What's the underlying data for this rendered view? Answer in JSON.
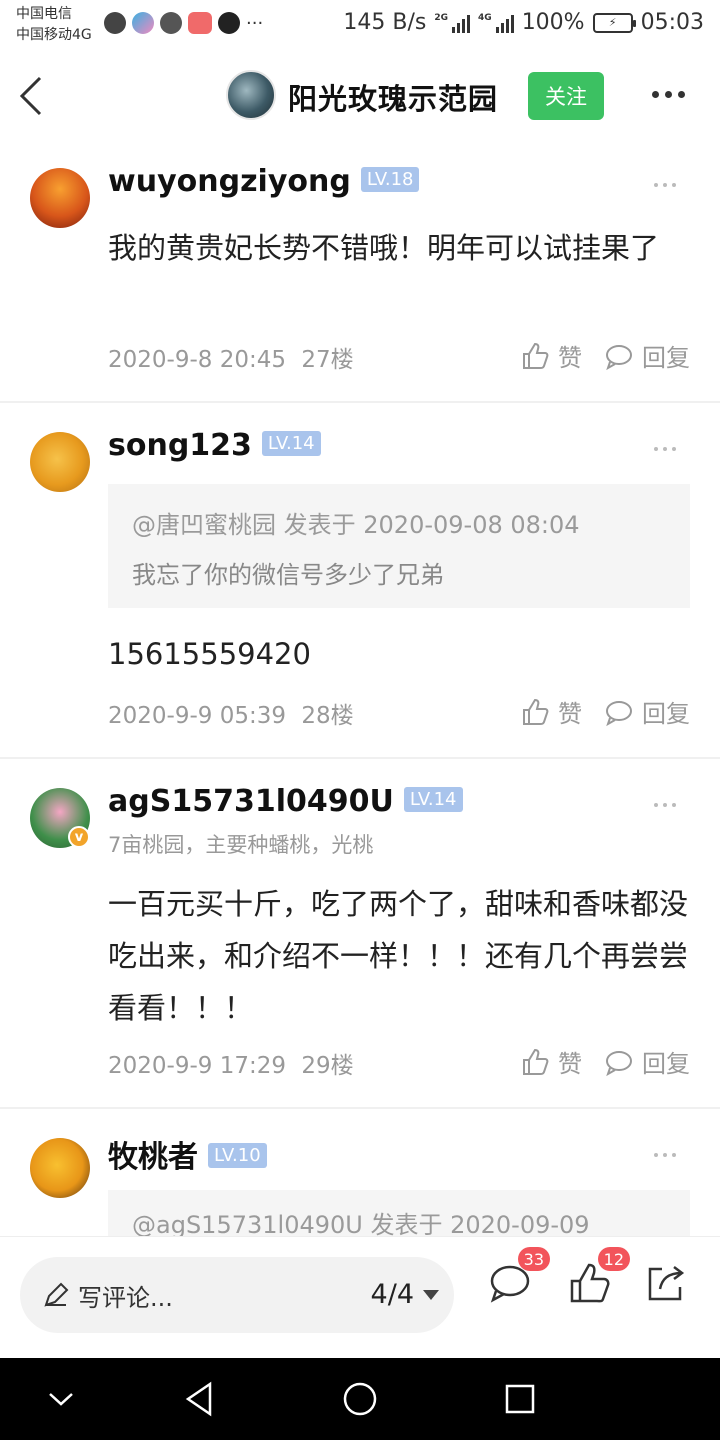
{
  "status_bar": {
    "carrier_1": "中国电信",
    "carrier_2": "中国移动4G",
    "net_speed": "145 B/s",
    "net_2g": "2G",
    "net_4g": "4G",
    "battery": "100%",
    "time": "05:03"
  },
  "header": {
    "title": "阳光玫瑰示范园",
    "follow_label": "关注"
  },
  "posts": [
    {
      "username": "wuyongziyong",
      "level": "LV.18",
      "text": "我的黄贵妃长势不错哦！明年可以试挂果了",
      "date": "2020-9-8 20:45",
      "floor": "27楼",
      "like_label": "赞",
      "reply_label": "回复"
    },
    {
      "username": "song123",
      "level": "LV.14",
      "quote_header": "@唐凹蜜桃园 发表于 2020-09-08 08:04",
      "quote_text": "我忘了你的微信号多少了兄弟",
      "text": "15615559420",
      "date": "2020-9-9 05:39",
      "floor": "28楼",
      "like_label": "赞",
      "reply_label": "回复"
    },
    {
      "username": "agS15731l0490U",
      "level": "LV.14",
      "subtitle": "7亩桃园，主要种蟠桃，光桃",
      "text": "一百元买十斤，吃了两个了，甜味和香味都没吃出来，和介绍不一样！！！还有几个再尝尝看看！！！",
      "date": "2020-9-9 17:29",
      "floor": "29楼",
      "like_label": "赞",
      "reply_label": "回复",
      "verified_mark": "v"
    },
    {
      "username": "牧桃者",
      "level": "LV.10",
      "quote_header": "@agS15731l0490U 发表于 2020-09-09"
    }
  ],
  "bottom_bar": {
    "input_placeholder": "写评论...",
    "page_indicator": "4/4",
    "comment_count": "33",
    "like_count": "12"
  }
}
